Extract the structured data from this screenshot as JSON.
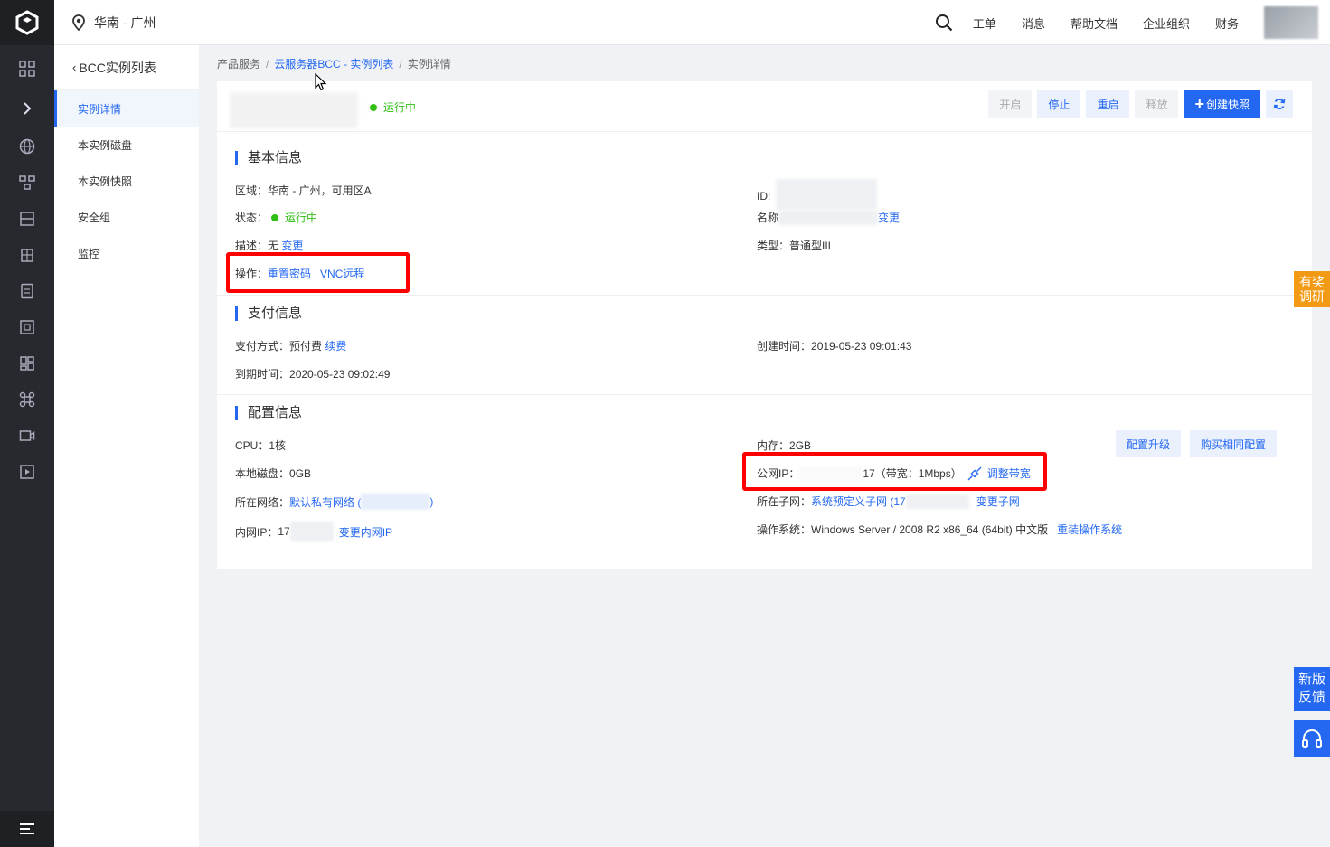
{
  "topbar": {
    "region": "华南 - 广州",
    "nav": [
      "工单",
      "消息",
      "帮助文档",
      "企业组织",
      "财务"
    ]
  },
  "sidebar": {
    "back_label": "BCC实例列表",
    "items": [
      {
        "label": "实例详情",
        "active": true
      },
      {
        "label": "本实例磁盘",
        "active": false
      },
      {
        "label": "本实例快照",
        "active": false
      },
      {
        "label": "安全组",
        "active": false
      },
      {
        "label": "监控",
        "active": false
      }
    ]
  },
  "breadcrumb": {
    "root": "产品服务",
    "parent": "云服务器BCC - 实例列表",
    "current": "实例详情",
    "separator": "/"
  },
  "header": {
    "status": "运行中",
    "buttons": {
      "start": "开启",
      "stop": "停止",
      "restart": "重启",
      "release": "释放",
      "create_snapshot": "创建快照"
    }
  },
  "basic": {
    "title": "基本信息",
    "region_label": "区域：",
    "region_value": "华南 - 广州，可用区A",
    "status_label": "状态：",
    "status_value": "运行中",
    "desc_label": "描述：",
    "desc_value": "无",
    "desc_change": "变更",
    "ops_label": "操作：",
    "ops_reset_pwd": "重置密码",
    "ops_vnc": "VNC远程",
    "id_label": "ID:",
    "name_label": "名称",
    "name_change": "变更",
    "type_label": "类型：",
    "type_value": "普通型III"
  },
  "payment": {
    "title": "支付信息",
    "method_label": "支付方式：",
    "method_value": "预付费",
    "renew": "续费",
    "expire_label": "到期时间：",
    "expire_value": "2020-05-23 09:02:49",
    "created_label": "创建时间：",
    "created_value": "2019-05-23 09:01:43"
  },
  "config": {
    "title": "配置信息",
    "cpu_label": "CPU：",
    "cpu_value": "1核",
    "disk_label": "本地磁盘：",
    "disk_value": "0GB",
    "network_label": "所在网络：",
    "network_value": "默认私有网络 (",
    "network_tail": ")",
    "private_ip_label": "内网IP：",
    "private_ip_prefix": "17",
    "private_ip_change": "变更内网IP",
    "memory_label": "内存：",
    "memory_value": "2GB",
    "public_ip_label": "公网IP：",
    "public_ip_suffix": "17",
    "bandwidth": "（带宽：1Mbps）",
    "adjust_bandwidth": "调整带宽",
    "subnet_label": "所在子网：",
    "subnet_value": "系统预定义子网 (17",
    "subnet_change": "变更子网",
    "os_label": "操作系统：",
    "os_value": "Windows Server / 2008 R2 x86_64 (64bit) 中文版",
    "os_reinstall": "重装操作系统",
    "upgrade": "配置升级",
    "buy_same": "购买相同配置"
  },
  "floats": {
    "survey": "有奖调研",
    "feedback": "新版反馈"
  },
  "colors": {
    "primary": "#2468f2",
    "running": "#30bf13",
    "annotation": "#ff0000",
    "survey": "#f29a13"
  }
}
